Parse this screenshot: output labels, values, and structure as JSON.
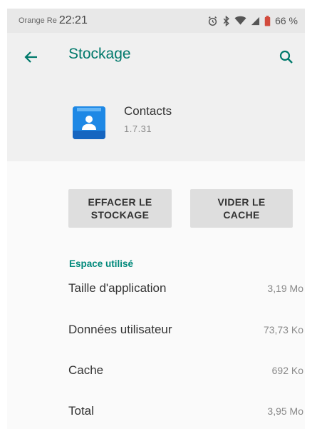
{
  "status_bar": {
    "carrier": "Orange Re",
    "time": "22:21",
    "battery": "66 %",
    "icons": [
      "alarm-icon",
      "bluetooth-icon",
      "wifi-icon",
      "signal-icon",
      "battery-icon"
    ]
  },
  "header": {
    "title": "Stockage",
    "back_icon": "arrow-left-icon",
    "search_icon": "search-icon"
  },
  "app": {
    "name": "Contacts",
    "version": "1.7.31",
    "icon": "contacts-icon"
  },
  "buttons": {
    "clear_storage_line1": "EFFACER LE",
    "clear_storage_line2": "STOCKAGE",
    "clear_cache_line1": "VIDER LE",
    "clear_cache_line2": "CACHE"
  },
  "storage": {
    "section_title": "Espace utilisé",
    "rows": [
      {
        "label": "Taille d'application",
        "value": "3,19 Mo"
      },
      {
        "label": "Données utilisateur",
        "value": "73,73 Ko"
      },
      {
        "label": "Cache",
        "value": "692 Ko"
      },
      {
        "label": "Total",
        "value": "3,95 Mo"
      }
    ]
  },
  "colors": {
    "accent": "#00796b",
    "app_icon": "#1e88e5"
  }
}
